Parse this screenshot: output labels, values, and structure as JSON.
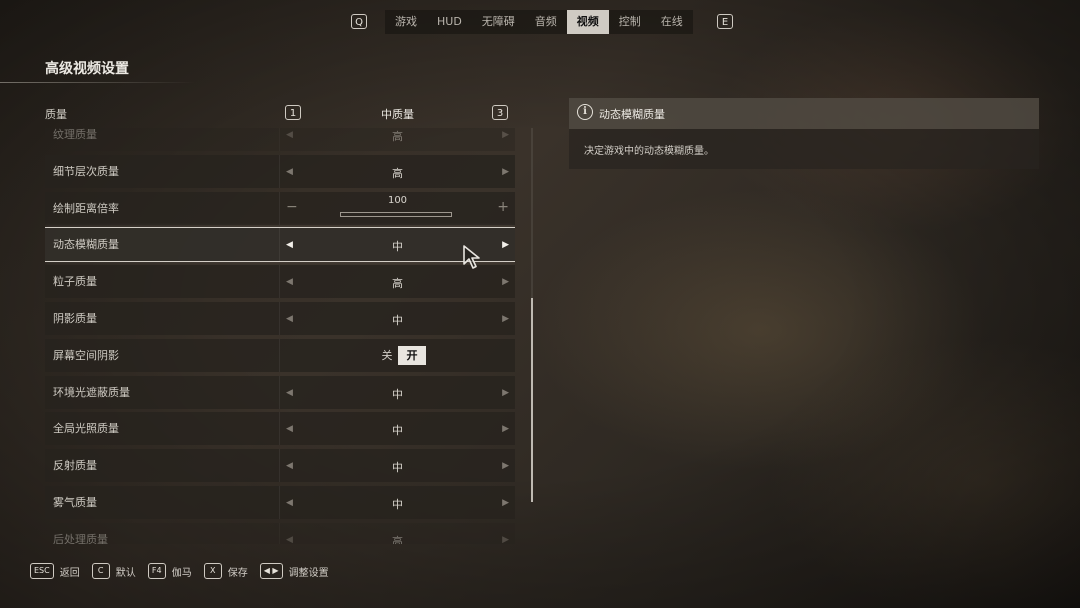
{
  "top_nav": {
    "prev_key": "Q",
    "next_key": "E",
    "tabs": [
      {
        "label": "游戏",
        "active": false
      },
      {
        "label": "HUD",
        "active": false
      },
      {
        "label": "无障碍",
        "active": false
      },
      {
        "label": "音频",
        "active": false
      },
      {
        "label": "视频",
        "active": true
      },
      {
        "label": "控制",
        "active": false
      },
      {
        "label": "在线",
        "active": false
      }
    ]
  },
  "page_title": "高级视频设置",
  "preset": {
    "label": "质量",
    "left_key": "1",
    "value": "中质量",
    "right_key": "3"
  },
  "settings": [
    {
      "name": "纹理质量",
      "value": "高",
      "type": "select",
      "faded": true
    },
    {
      "name": "细节层次质量",
      "value": "高",
      "type": "select"
    },
    {
      "name": "绘制距离倍率",
      "value": "100",
      "type": "slider",
      "minus": "−",
      "plus": "+"
    },
    {
      "name": "动态模糊质量",
      "value": "中",
      "type": "select",
      "selected": true
    },
    {
      "name": "粒子质量",
      "value": "高",
      "type": "select"
    },
    {
      "name": "阴影质量",
      "value": "中",
      "type": "select"
    },
    {
      "name": "屏幕空间阴影",
      "type": "toggle",
      "off_label": "关",
      "on_label": "开",
      "value": "开"
    },
    {
      "name": "环境光遮蔽质量",
      "value": "中",
      "type": "select"
    },
    {
      "name": "全局光照质量",
      "value": "中",
      "type": "select"
    },
    {
      "name": "反射质量",
      "value": "中",
      "type": "select"
    },
    {
      "name": "雾气质量",
      "value": "中",
      "type": "select"
    },
    {
      "name": "后处理质量",
      "value": "高",
      "type": "select",
      "faded": true
    }
  ],
  "info_panel": {
    "title": "动态模糊质量",
    "description": "决定游戏中的动态模糊质量。"
  },
  "footer": {
    "hints": [
      {
        "key": "ESC",
        "label": "返回"
      },
      {
        "key": "C",
        "label": "默认"
      },
      {
        "key": "F4",
        "label": "伽马"
      },
      {
        "key": "X",
        "label": "保存"
      },
      {
        "key": "◀ ▶",
        "label": "调整设置"
      }
    ]
  },
  "colors": {
    "accent": "#cfcbc3",
    "selected_outline": "#d5d0c8"
  }
}
